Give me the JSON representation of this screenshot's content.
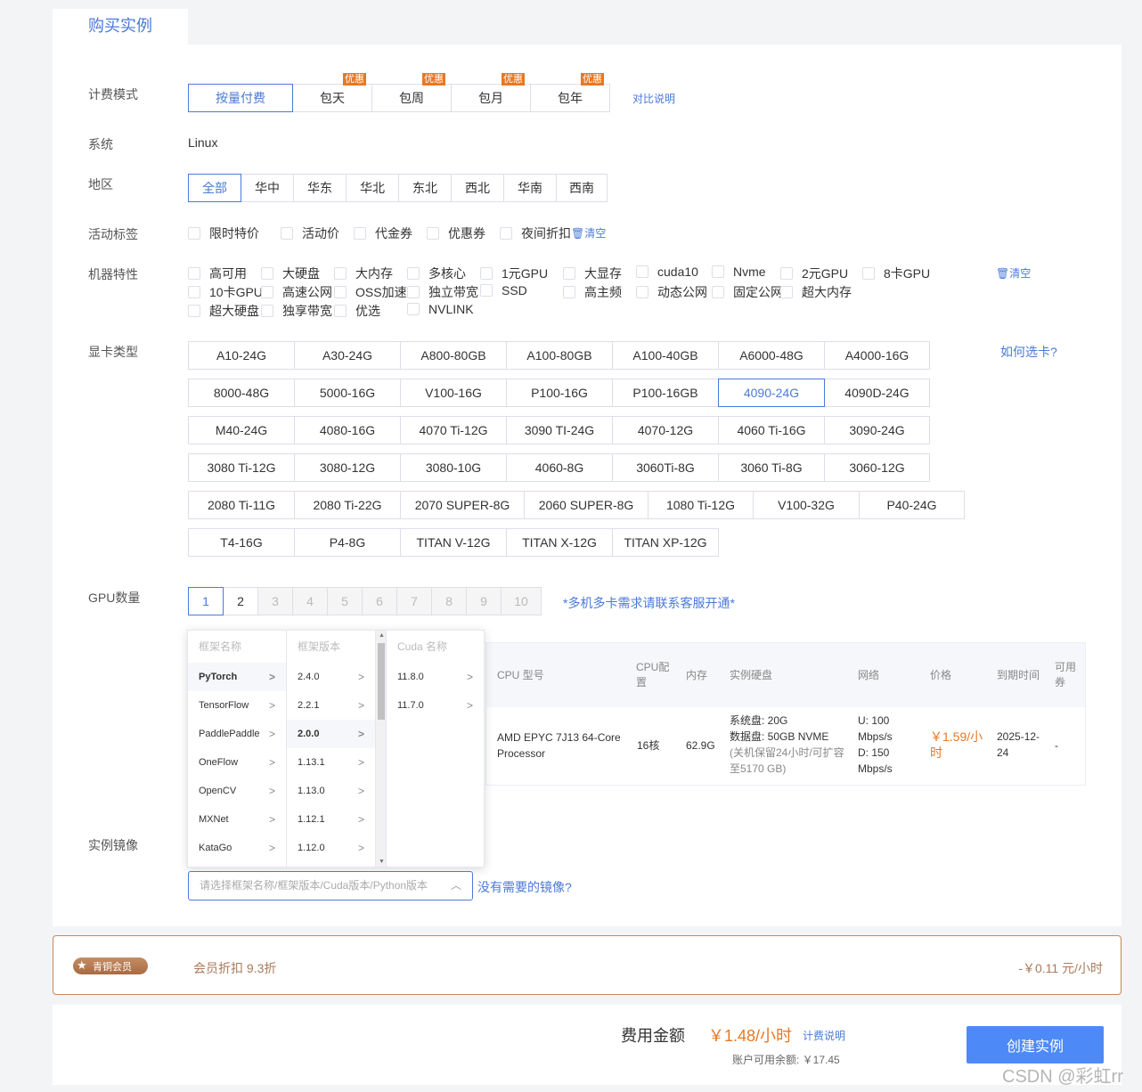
{
  "tab_title": "购买实例",
  "billing": {
    "label": "计费模式",
    "options": [
      {
        "text": "按量付费",
        "badge": ""
      },
      {
        "text": "包天",
        "badge": "优惠"
      },
      {
        "text": "包周",
        "badge": "优惠"
      },
      {
        "text": "包月",
        "badge": "优惠"
      },
      {
        "text": "包年",
        "badge": "优惠"
      }
    ],
    "compare_link": "对比说明"
  },
  "system": {
    "label": "系统",
    "value": "Linux"
  },
  "region": {
    "label": "地区",
    "options": [
      "全部",
      "华中",
      "华东",
      "华北",
      "东北",
      "西北",
      "华南",
      "西南"
    ]
  },
  "activity": {
    "label": "活动标签",
    "options": [
      "限时特价",
      "活动价",
      "代金券",
      "优惠券",
      "夜间折扣"
    ],
    "clear": "清空"
  },
  "features": {
    "label": "机器特性",
    "rows": [
      [
        "高可用",
        "大硬盘",
        "大内存",
        "多核心",
        "1元GPU",
        "大显存",
        "cuda10",
        "Nvme",
        "2元GPU",
        "8卡GPU"
      ],
      [
        "10卡GPU",
        "高速公网",
        "OSS加速",
        "独立带宽",
        "SSD",
        "高主频",
        "动态公网",
        "固定公网",
        "超大内存"
      ],
      [
        "超大硬盘",
        "独享带宽",
        "优选",
        "NVLINK"
      ]
    ],
    "clear": "清空"
  },
  "gpu_type": {
    "label": "显卡类型",
    "help": "如何选卡?",
    "rows": [
      [
        "A10-24G",
        "A30-24G",
        "A800-80GB",
        "A100-80GB",
        "A100-40GB",
        "A6000-48G",
        "A4000-16G"
      ],
      [
        "8000-48G",
        "5000-16G",
        "V100-16G",
        "P100-16G",
        "P100-16GB",
        "4090-24G",
        "4090D-24G"
      ],
      [
        "M40-24G",
        "4080-16G",
        "4070 Ti-12G",
        "3090 TI-24G",
        "4070-12G",
        "4060 Ti-16G",
        "3090-24G"
      ],
      [
        "3080 Ti-12G",
        "3080-12G",
        "3080-10G",
        "4060-8G",
        "3060Ti-8G",
        "3060 Ti-8G",
        "3060-12G"
      ],
      [
        "2080 Ti-11G",
        "2080 Ti-22G",
        "2070 SUPER-8G",
        "2060 SUPER-8G",
        "1080 Ti-12G",
        "V100-32G",
        "P40-24G"
      ],
      [
        "T4-16G",
        "P4-8G",
        "TITAN V-12G",
        "TITAN X-12G",
        "TITAN XP-12G"
      ]
    ],
    "selected": "4090-24G"
  },
  "gpu_count": {
    "label": "GPU数量",
    "options": [
      "1",
      "2",
      "3",
      "4",
      "5",
      "6",
      "7",
      "8",
      "9",
      "10"
    ],
    "note": "*多机多卡需求请联系客服开通*"
  },
  "table": {
    "headers": [
      "CPU 型号",
      "CPU配置",
      "内存",
      "实例硬盘",
      "网络",
      "价格",
      "到期时间",
      "可用券"
    ],
    "row": {
      "cpu_model": "AMD EPYC 7J13 64-Core Processor",
      "cpu_cores": "16核",
      "memory": "62.9G",
      "disk_sys": "系统盘:  20G",
      "disk_data": "数据盘:  50GB NVME",
      "disk_note": "(关机保留24小时/可扩容至5170 GB)",
      "net_up": "U:  100 Mbps/s",
      "net_down": "D:  150 Mbps/s",
      "price": "￥1.59/小时",
      "expire": "2025-12-24",
      "coupon": "-"
    }
  },
  "image": {
    "label": "实例镜像",
    "dropdown": {
      "col1_header": "框架名称",
      "col2_header": "框架版本",
      "col3_header": "Cuda 名称",
      "frameworks": [
        "PyTorch",
        "TensorFlow",
        "PaddlePaddle",
        "OneFlow",
        "OpenCV",
        "MXNet",
        "KataGo"
      ],
      "versions": [
        "2.4.0",
        "2.2.1",
        "2.0.0",
        "1.13.1",
        "1.13.0",
        "1.12.1",
        "1.12.0"
      ],
      "cuda": [
        "11.8.0",
        "11.7.0"
      ]
    },
    "placeholder": "请选择框架名称/框架版本/Cuda版本/Python版本",
    "missing_link": "没有需要的镜像?"
  },
  "member": {
    "badge": "青铜会员",
    "discount": "会员折扣 9.3折",
    "saving": "-￥0.11 元/小时"
  },
  "footer": {
    "fee_label": "费用金额",
    "fee_value": "￥1.48/小时",
    "fee_help": "计费说明",
    "balance": "账户可用余额: ￥17.45",
    "create_button": "创建实例",
    "watermark": "CSDN @彩虹rr"
  },
  "colors": {
    "accent": "#4a7ad8",
    "orange": "#e87722",
    "button": "#4e8af7"
  }
}
